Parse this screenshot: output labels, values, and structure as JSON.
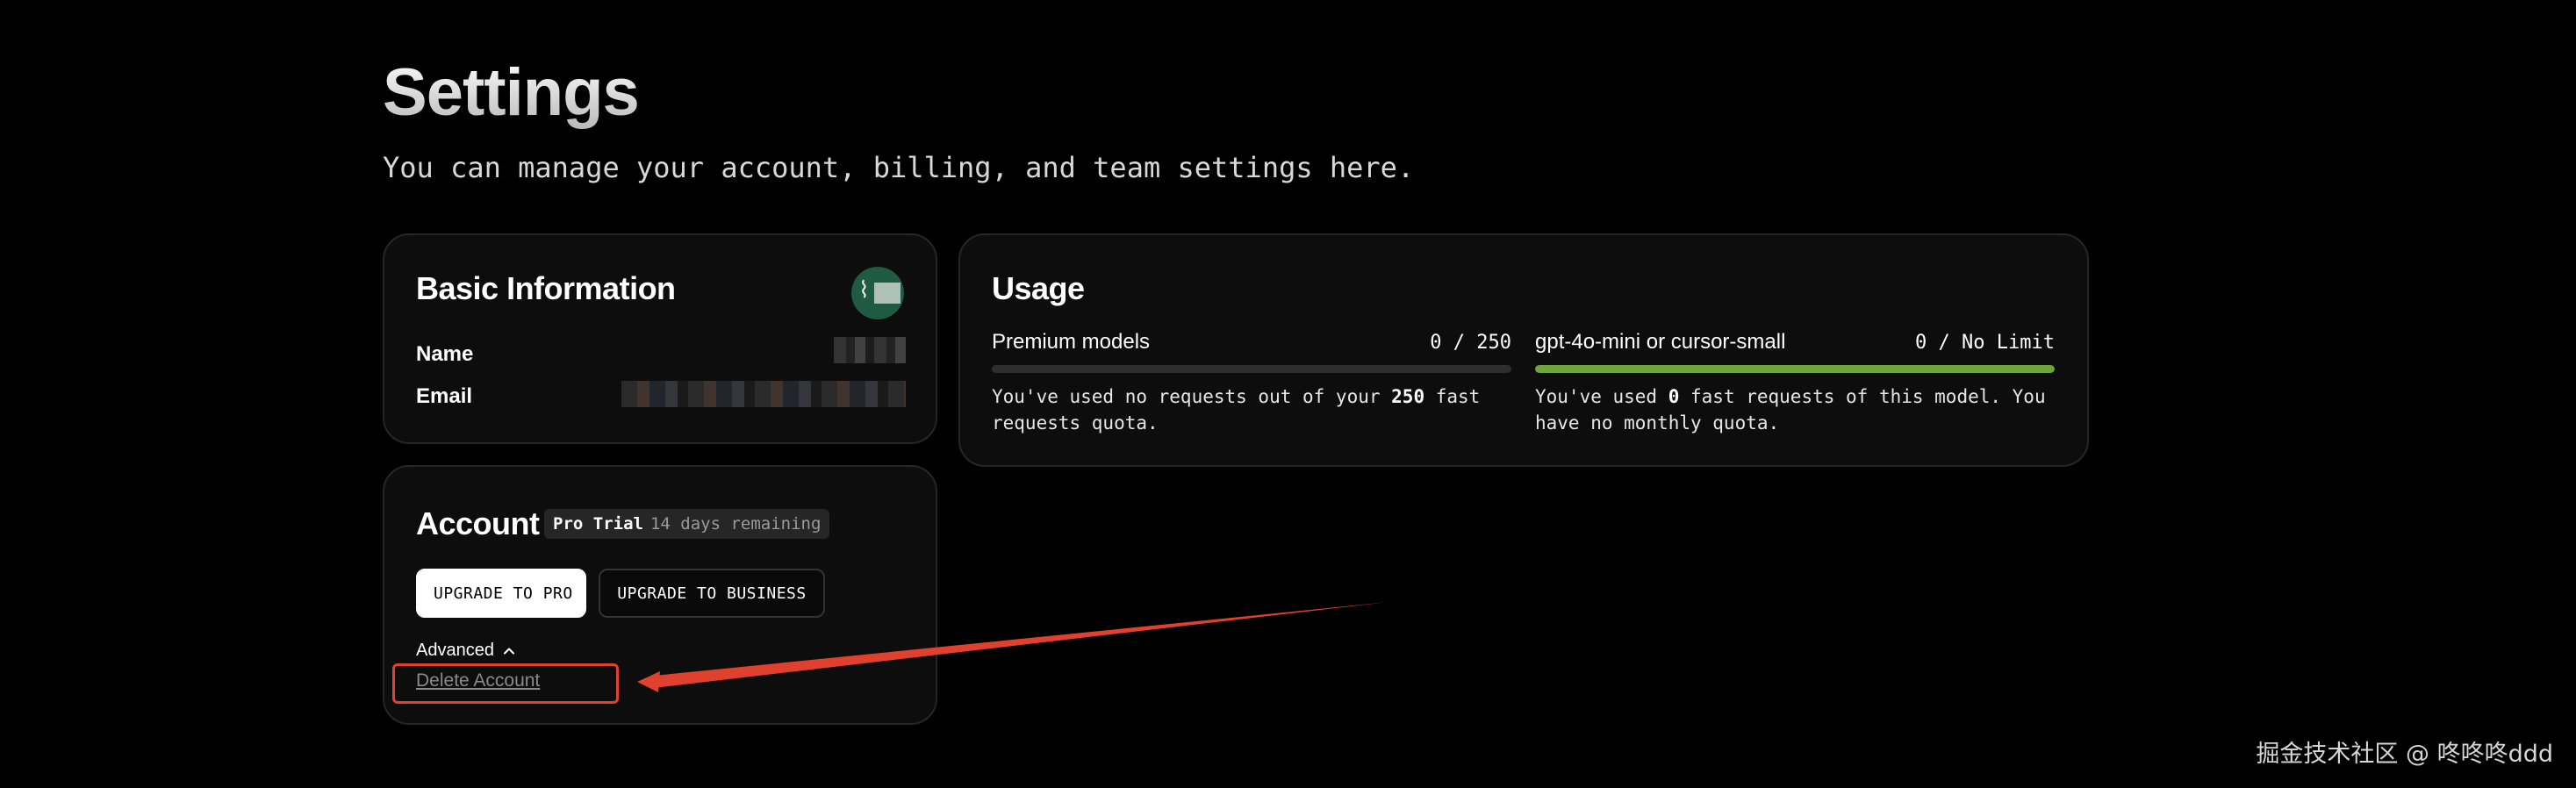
{
  "page": {
    "title": "Settings",
    "subtitle": "You can manage your account, billing, and team settings here."
  },
  "basic_info": {
    "title": "Basic Information",
    "name_label": "Name",
    "email_label": "Email"
  },
  "usage": {
    "title": "Usage",
    "premium": {
      "name": "Premium models",
      "count": "0 / 250",
      "used": 0,
      "limit": 250,
      "desc_before": "You've used no requests out of your ",
      "desc_bold": "250",
      "desc_after": " fast requests quota.",
      "bar_color": "#2e2e2e"
    },
    "small": {
      "name": "gpt-4o-mini or cursor-small",
      "count": "0 / No Limit",
      "fill_fraction": 1.0,
      "desc_before": "You've used ",
      "desc_bold": "0",
      "desc_after": " fast requests of this model. You have no monthly quota.",
      "bar_color": "#6fa33c"
    }
  },
  "account": {
    "title": "Account",
    "plan_name": "Pro Trial",
    "plan_remaining": "14 days remaining",
    "upgrade_pro_label": "UPGRADE TO PRO",
    "upgrade_business_label": "UPGRADE TO BUSINESS",
    "advanced_label": "Advanced",
    "delete_label": "Delete Account"
  },
  "annotation": {
    "color": "#e0402e"
  },
  "watermark": "掘金技术社区 @ 咚咚咚ddd"
}
